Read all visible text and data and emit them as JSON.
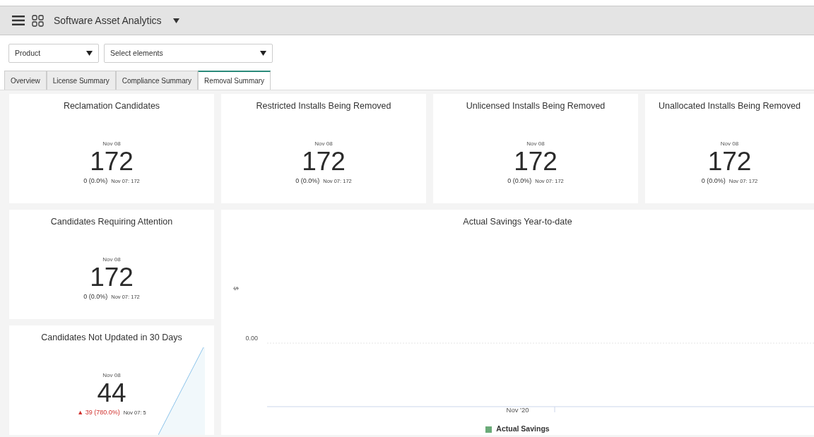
{
  "header": {
    "title": "Software Asset Analytics"
  },
  "filters": [
    {
      "value": "Product"
    },
    {
      "value": "Select elements"
    }
  ],
  "tabs": [
    {
      "label": "Overview",
      "selected": false
    },
    {
      "label": "License Summary",
      "selected": false
    },
    {
      "label": "Compliance Summary",
      "selected": false
    },
    {
      "label": "Removal Summary",
      "selected": true
    }
  ],
  "cards": [
    {
      "title": "Reclamation Candidates",
      "date": "Nov 08",
      "value": "172",
      "change": "0 (0.0%)",
      "alert": false,
      "previous": "Nov 07: 172",
      "sparkline": false
    },
    {
      "title": "Restricted Installs Being Removed",
      "date": "Nov 08",
      "value": "172",
      "change": "0 (0.0%)",
      "alert": false,
      "previous": "Nov 07: 172",
      "sparkline": false
    },
    {
      "title": "Unlicensed Installs Being Removed",
      "date": "Nov 08",
      "value": "172",
      "change": "0 (0.0%)",
      "alert": false,
      "previous": "Nov 07: 172",
      "sparkline": false
    },
    {
      "title": "Unallocated Installs Being Removed",
      "date": "Nov 08",
      "value": "172",
      "change": "0 (0.0%)",
      "alert": false,
      "previous": "Nov 07: 172",
      "sparkline": false
    },
    {
      "title": "Candidates Requiring Attention",
      "date": "Nov 08",
      "value": "172",
      "change": "0 (0.0%)",
      "alert": false,
      "previous": "Nov 07: 172",
      "sparkline": false
    },
    {
      "title": "Candidates Not Updated in 30 Days",
      "date": "Nov 08",
      "value": "44",
      "arrow": "▲",
      "change": "39 (780.0%)",
      "alert": true,
      "previous": "Nov 07: 5",
      "sparkline": true
    }
  ],
  "savings_chart": {
    "title": "Actual Savings Year-to-date",
    "y_axis_label": "$",
    "y_tick": "0.00",
    "x_tick": "Nov '20",
    "legend": {
      "label": "Actual Savings",
      "color": "#6aaa78"
    }
  }
}
